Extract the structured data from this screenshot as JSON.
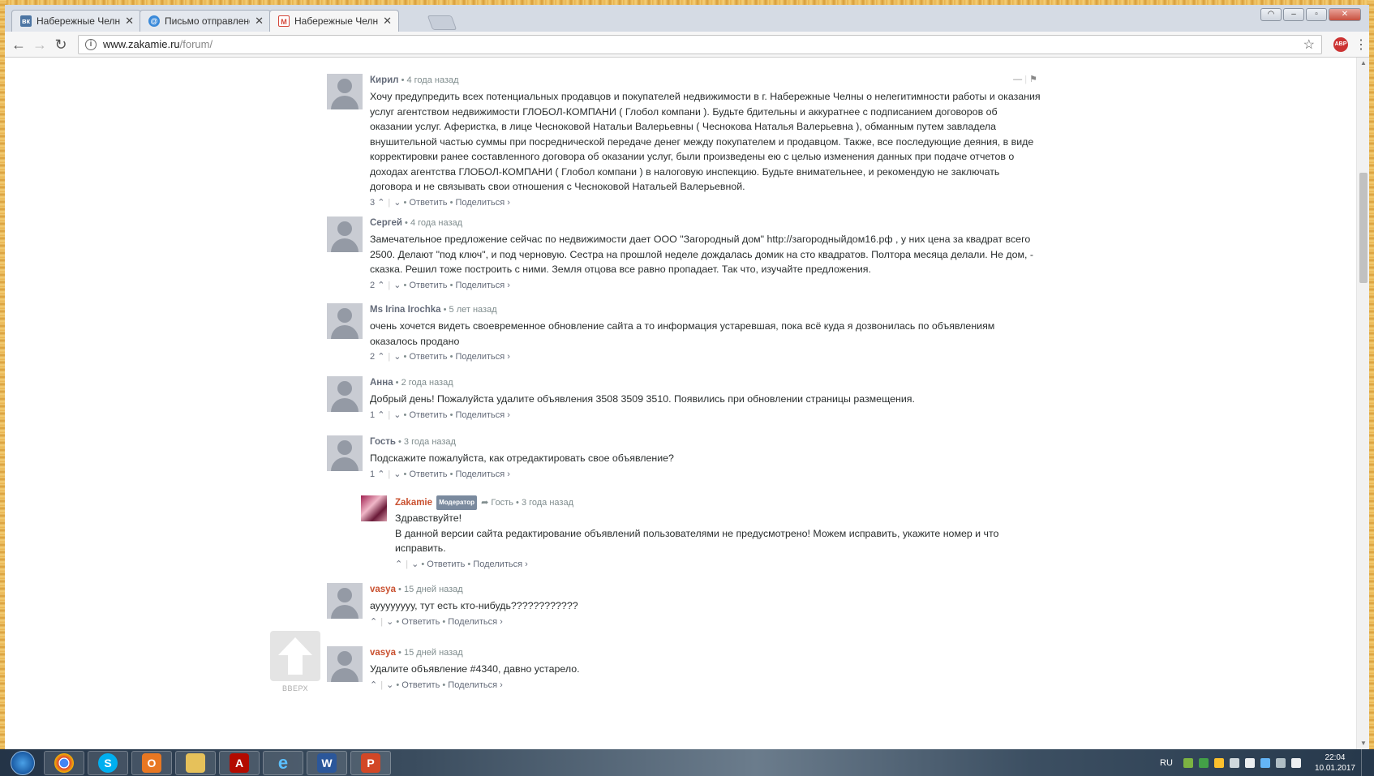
{
  "browser": {
    "tabs": [
      {
        "label": "Набережные Челны -Н",
        "favicon": "vk-icon",
        "color": "#4c75a3",
        "active": false
      },
      {
        "label": "Письмо отправлено - П",
        "favicon": "mail-icon",
        "color": "#3b8ad9",
        "active": false
      },
      {
        "label": "Набережные Челны. Ф",
        "favicon": "gmail-icon",
        "color": "#d44638",
        "active": true
      }
    ],
    "address": {
      "host": "www.zakamie.ru",
      "path": "/forum/"
    },
    "ext_badge": "ABP"
  },
  "comments": [
    {
      "author": "Кирил",
      "time": "4 года назад",
      "votes": "3",
      "text": "Хочу предупредить всех потенциальных продавцов и покупателей недвижимости в г. Набережные Челны о нелегитимности работы и оказания услуг агентством недвижимости ГЛОБОЛ-КОМПАНИ ( Глобол компани ). Будьте бдительны и аккуратнее с подписанием договоров об оказании услуг. Аферистка, в лице Чесноковой Натальи Валерьевны ( Чеснокова Наталья Валерьевна ), обманным путем завладела внушительной частью суммы при посреднической передаче денег между покупателем и продавцом. Также, все последующие деяния, в виде корректировки ранее составленного договора об оказании услуг, были произведены ею с целью изменения данных при подаче отчетов о доходах агентства ГЛОБОЛ-КОМПАНИ ( Глобол компани ) в налоговую инспекцию. Будьте внимательнее, и рекомендую не заключать договора и не связывать свои отношения с Чесноковой Натальей Валерьевной."
    },
    {
      "author": "Сергей",
      "time": "4 года назад",
      "votes": "2",
      "text": "Замечательное предложение сейчас по недвижимости дает ООО \"Загородный дом\" http://загородныйдом16.рф , у них цена за квадрат всего 2500. Делают \"под ключ\", и под черновую. Сестра на прошлой неделе дождалась домик на сто квадратов. Полтора месяца делали. Не дом, - сказка. Решил тоже построить с ними. Земля отцова все равно пропадает. Так что, изучайте предложения."
    },
    {
      "author": "Ms Irina Irochka",
      "time": "5 лет назад",
      "votes": "2",
      "text": "очень хочется видеть своевременное обновление сайта а то информация устаревшая, пока всё куда я дозвонилась по объявлениям оказалось продано"
    },
    {
      "author": "Анна",
      "time": "2 года назад",
      "votes": "1",
      "text": "Добрый день! Пожалуйста удалите объявления 3508 3509 3510. Появились при обновлении страницы размещения."
    },
    {
      "author": "Гость",
      "time": "3 года назад",
      "votes": "1",
      "text": "Подскажите пожалуйста, как отредактировать свое объявление?"
    },
    {
      "author": "Zakamie",
      "badge": "Модератор",
      "reply_to": "Гость",
      "time": "3 года назад",
      "votes": "",
      "text": "Здравствуйте!",
      "text2": "В данной версии сайта редактирование объявлений пользователями не предусмотрено! Можем исправить, укажите номер и что исправить."
    },
    {
      "author": "vasya",
      "time": "15 дней назад",
      "votes": "",
      "text": "ауууууууу, тут есть кто-нибудь????????????"
    },
    {
      "author": "vasya",
      "time": "15 дней назад",
      "votes": "",
      "text": "Удалите объявление #4340, давно устарело."
    }
  ],
  "actions": {
    "reply": "Ответить",
    "share": "Поделиться ›",
    "up": "⌃",
    "down": "⌄",
    "dot": "•"
  },
  "to_top": {
    "label": "ВВЕРХ"
  },
  "taskbar": {
    "apps": [
      {
        "name": "chrome-icon",
        "glyph": "",
        "color": "#db4437"
      },
      {
        "name": "skype-icon",
        "glyph": "S",
        "color": "#00aff0"
      },
      {
        "name": "outlook-icon",
        "glyph": "O",
        "color": "#e87722"
      },
      {
        "name": "explorer-icon",
        "glyph": "",
        "color": "#e6c15a"
      },
      {
        "name": "acrobat-icon",
        "glyph": "A",
        "color": "#b30b00"
      },
      {
        "name": "ie-icon",
        "glyph": "e",
        "color": "#1e90ff"
      },
      {
        "name": "word-icon",
        "glyph": "W",
        "color": "#2b579a"
      },
      {
        "name": "powerpoint-icon",
        "glyph": "P",
        "color": "#d24726"
      }
    ],
    "lang": "RU",
    "time": "22:04",
    "date": "10.01.2017"
  }
}
